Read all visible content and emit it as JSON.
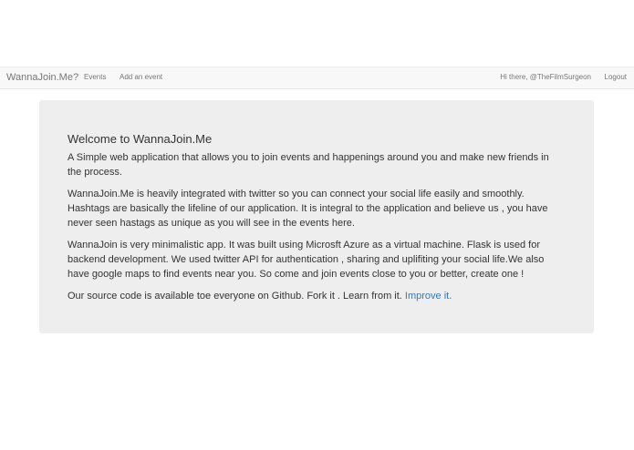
{
  "navbar": {
    "brand": "WannaJoin.Me?",
    "links": {
      "events": "Events",
      "add_event": "Add an event"
    },
    "greeting": "Hi there, @TheFilmSurgeon",
    "logout": "Logout"
  },
  "jumbotron": {
    "title": "Welcome to WannaJoin.Me",
    "paragraphs": [
      "A Simple web application that allows you to join events and happenings around you and make new friends in the process.",
      "WannaJoin.Me is heavily integrated with twitter so you can connect your social life easily and smoothly. Hashtags are basically the lifeline of our application. It is integral to the application and believe us , you have never seen hastags as unique as you will see in the events here.",
      "WannaJoin is very minimalistic app. It was built using Microsft Azure as a virtual machine. Flask is used for backend development. We used twitter API for authentication , sharing and uplifiting your social life.We also have google maps to find events near you. So come and join events close to you or better, create one !"
    ],
    "source_text": "Our source code is available toe everyone on Github. Fork it . Learn from it.",
    "improve_link": "Improve it."
  },
  "colors": {
    "navbar_bg": "#f8f8f8",
    "jumbotron_bg": "#eeeeee",
    "link": "#337ab7",
    "nav_text": "#777777"
  }
}
